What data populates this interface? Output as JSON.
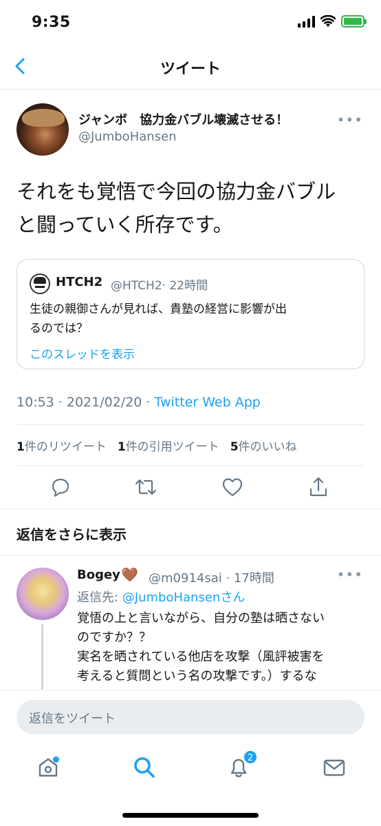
{
  "status_bar": {
    "time": "9:35"
  },
  "header": {
    "title": "ツイート"
  },
  "tweet": {
    "display_name": "ジャンボ　協力金バブル壊滅させる！",
    "handle": "@JumboHansen",
    "text_lines": [
      "それをも覚悟で今回の協力金バブル",
      "と闘っていく所存です。"
    ],
    "quote": {
      "name": "HTCH2",
      "handle": "@HTCH2",
      "time": "· 22時間",
      "text_lines": [
        "生徒の親御さんが見れば、貴塾の経営に影響が出",
        "るのでは？"
      ],
      "link": "このスレッドを表示"
    },
    "meta": {
      "time": "10:53 · 2021/02/20 · ",
      "app": "Twitter Web App"
    },
    "stats": {
      "retweets_count": "1",
      "retweets_label": "件のリツイート",
      "quotes_count": "1",
      "quotes_label": "件の引用ツイート",
      "likes_count": "5",
      "likes_label": "件のいいね"
    }
  },
  "more_replies": "返信をさらに表示",
  "reply": {
    "name": "Bogey",
    "heart": "🤎",
    "handle_time": "@m0914sai · 17時間",
    "reply_to_prefix": "返信先: ",
    "reply_to_who": "@JumboHansenさん",
    "text_lines": [
      "覚悟の上と言いながら、自分の塾は晒さない",
      "のですか？？",
      "実名を晒されている他店を攻撃（風評被害を",
      "考えると質問という名の攻撃です。）するな"
    ]
  },
  "composer": {
    "placeholder": "返信をツイート"
  },
  "tabbar": {
    "notifications_badge": "2"
  },
  "colors": {
    "accent": "#1da1f2",
    "battery": "#2fb84a"
  }
}
